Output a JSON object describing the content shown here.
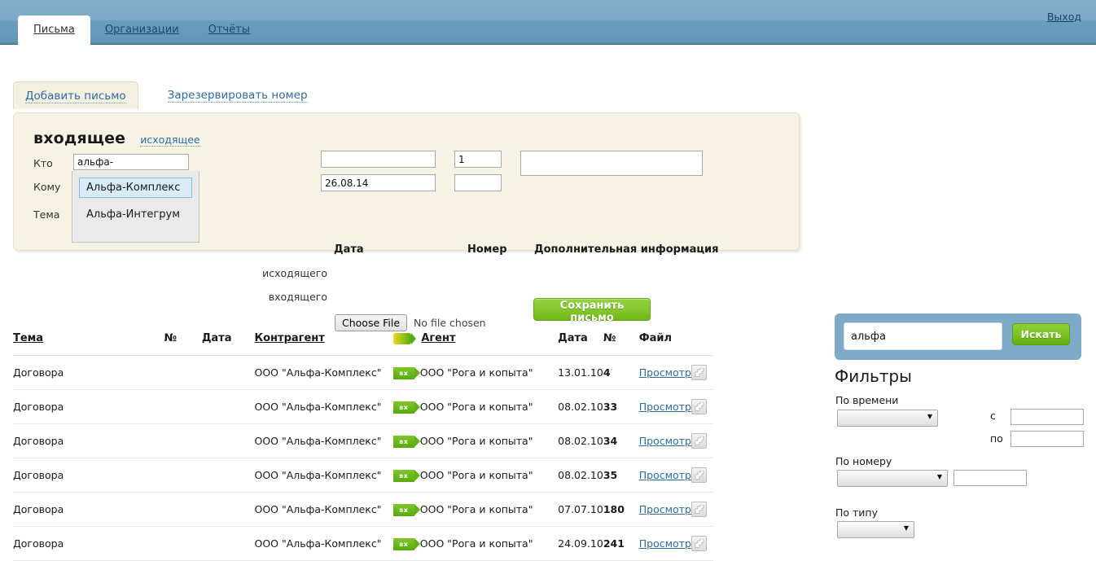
{
  "topbar": {
    "logout_label": "Выход",
    "tabs": [
      {
        "label": "Письма",
        "active": true
      },
      {
        "label": "Организации",
        "active": false
      },
      {
        "label": "Отчёты",
        "active": false
      }
    ]
  },
  "subtabs": [
    {
      "label": "Добавить письмо",
      "active": true
    },
    {
      "label": "Зарезервировать номер",
      "active": false
    }
  ],
  "form": {
    "direction_active": "входящее",
    "direction_other": "исходящее",
    "label_kto": "Кто",
    "label_komu": "Кому",
    "label_tema": "Тема",
    "value_kto": "альфа-",
    "value_komu": "",
    "value_tema": "",
    "header_date": "Дата",
    "header_number": "Номер",
    "header_extra": "Дополнительная информация",
    "row_outgoing_label": "исходящего",
    "row_incoming_label": "входящего",
    "date_outgoing": "",
    "date_incoming": "26.08.14",
    "number_outgoing": "1",
    "number_incoming": "",
    "extra_value": "",
    "choose_file_label": "Choose File",
    "no_file_label": "No file chosen",
    "save_label": "Сохранить письмо"
  },
  "autocomplete": {
    "items": [
      {
        "label": "Альфа-Комплекс",
        "selected": true
      },
      {
        "label": "Альфа-Интегрум",
        "selected": false
      }
    ]
  },
  "table": {
    "columns": [
      "Тема",
      "№",
      "Дата",
      "Контрагент",
      "Агент",
      "Дата",
      "№",
      "Файл",
      ""
    ],
    "view_label": "Просмотр",
    "badge_label": "вх",
    "rows": [
      {
        "tema": "Договора",
        "no": "",
        "date": "",
        "counterparty": "ООО \"Альфа-Комплекс\"",
        "agent": "ООО \"Рога и копыта\"",
        "date2": "13.01.10",
        "num2": "4"
      },
      {
        "tema": "Договора",
        "no": "",
        "date": "",
        "counterparty": "ООО \"Альфа-Комплекс\"",
        "agent": "ООО \"Рога и копыта\"",
        "date2": "08.02.10",
        "num2": "33"
      },
      {
        "tema": "Договора",
        "no": "",
        "date": "",
        "counterparty": "ООО \"Альфа-Комплекс\"",
        "agent": "ООО \"Рога и копыта\"",
        "date2": "08.02.10",
        "num2": "34"
      },
      {
        "tema": "Договора",
        "no": "",
        "date": "",
        "counterparty": "ООО \"Альфа-Комплекс\"",
        "agent": "ООО \"Рога и копыта\"",
        "date2": "08.02.10",
        "num2": "35"
      },
      {
        "tema": "Договора",
        "no": "",
        "date": "",
        "counterparty": "ООО \"Альфа-Комплекс\"",
        "agent": "ООО \"Рога и копыта\"",
        "date2": "07.07.10",
        "num2": "180"
      },
      {
        "tema": "Договора",
        "no": "",
        "date": "",
        "counterparty": "ООО \"Альфа-Комплекс\"",
        "agent": "ООО \"Рога и копыта\"",
        "date2": "24.09.10",
        "num2": "241"
      }
    ]
  },
  "search": {
    "value": "альфа",
    "button_label": "Искать"
  },
  "filters": {
    "title": "Фильтры",
    "time_label": "По времени",
    "time_select_value": "",
    "from_label": "с",
    "from_value": "",
    "to_label": "по",
    "to_value": "",
    "number_label": "По номеру",
    "number_select_value": "",
    "number_value": "",
    "type_label": "По типу",
    "type_select_value": ""
  },
  "colors": {
    "header_blue": "#7eaac8",
    "panel_cream": "#f6f3e5",
    "accent_green": "#7cc423",
    "link_blue": "#2b6ca3"
  }
}
